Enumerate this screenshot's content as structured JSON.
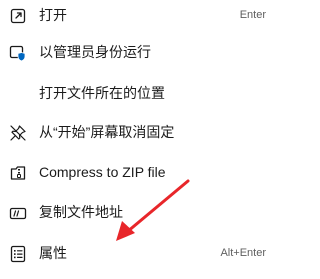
{
  "menu": {
    "items": [
      {
        "label": "打开",
        "shortcut": "Enter",
        "icon": "open-icon"
      },
      {
        "label": "以管理员身份运行",
        "shortcut": "",
        "icon": "shield-icon"
      },
      {
        "label": "打开文件所在的位置",
        "shortcut": "",
        "icon": ""
      },
      {
        "label": "从“开始”屏幕取消固定",
        "shortcut": "",
        "icon": "unpin-icon"
      },
      {
        "label": "Compress to ZIP file",
        "shortcut": "",
        "icon": "zip-icon"
      },
      {
        "label": "复制文件地址",
        "shortcut": "",
        "icon": "copy-path-icon"
      },
      {
        "label": "属性",
        "shortcut": "Alt+Enter",
        "icon": "properties-icon"
      }
    ]
  },
  "colors": {
    "accent": "#0067c0",
    "annotation_arrow": "#e8262a"
  }
}
